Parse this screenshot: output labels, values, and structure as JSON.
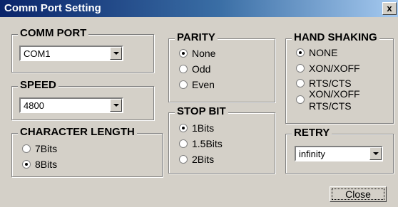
{
  "window": {
    "title": "Comm Port Setting",
    "close_glyph": "x"
  },
  "comm_port": {
    "legend": "COMM PORT",
    "value": "COM1"
  },
  "speed": {
    "legend": "SPEED",
    "value": "4800"
  },
  "character_length": {
    "legend": "CHARACTER LENGTH",
    "options": [
      "7Bits",
      "8Bits"
    ],
    "selected": "8Bits"
  },
  "parity": {
    "legend": "PARITY",
    "options": [
      "None",
      "Odd",
      "Even"
    ],
    "selected": "None"
  },
  "stop_bit": {
    "legend": "STOP BIT",
    "options": [
      "1Bits",
      "1.5Bits",
      "2Bits"
    ],
    "selected": "1Bits"
  },
  "hand_shaking": {
    "legend": "HAND SHAKING",
    "options": [
      "NONE",
      "XON/XOFF",
      "RTS/CTS",
      "XON/XOFF",
      "RTS/CTS"
    ],
    "selected": "NONE"
  },
  "retry": {
    "legend": "RETRY",
    "value": "infinity"
  },
  "close_button": {
    "label": "Close"
  }
}
